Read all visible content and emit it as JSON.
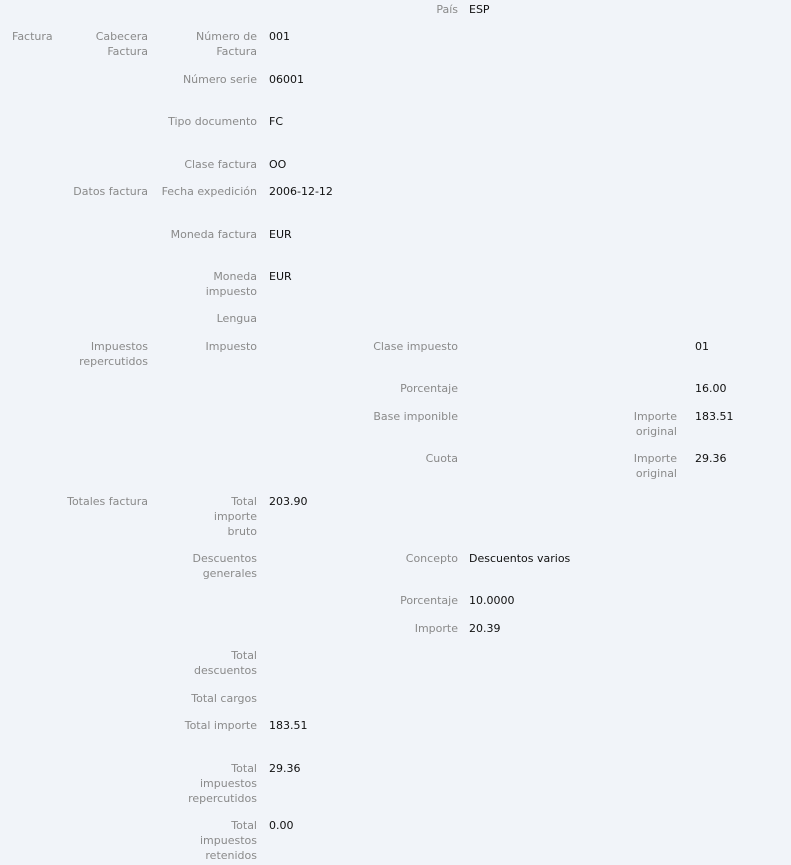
{
  "fields": {
    "pais": {
      "label": "País",
      "value": "ESP"
    },
    "factura": {
      "label": "Factura"
    },
    "cabecera": {
      "label": "Cabecera Factura"
    },
    "numero_factura": {
      "label": "Número de Factura",
      "value": "001"
    },
    "numero_serie": {
      "label": "Número serie",
      "value": "06001"
    },
    "tipo_documento": {
      "label": "Tipo documento",
      "value": "FC"
    },
    "clase_factura": {
      "label": "Clase factura",
      "value": "OO"
    },
    "datos_factura": {
      "label": "Datos factura"
    },
    "fecha_expedicion": {
      "label": "Fecha expedición",
      "value": "2006-12-12"
    },
    "moneda_factura": {
      "label": "Moneda factura",
      "value": "EUR"
    },
    "moneda_impuesto": {
      "label": "Moneda impuesto",
      "value": "EUR"
    },
    "lengua": {
      "label": "Lengua"
    },
    "impuestos_repercutidos": {
      "label": "Impuestos repercutidos"
    },
    "impuesto": {
      "label": "Impuesto"
    },
    "clase_impuesto": {
      "label": "Clase impuesto",
      "value": "01"
    },
    "porcentaje_impuesto": {
      "label": "Porcentaje",
      "value": "16.00"
    },
    "base_imponible": {
      "label": "Base imponible",
      "sublabel": "Importe original",
      "value": "183.51"
    },
    "cuota": {
      "label": "Cuota",
      "sublabel": "Importe original",
      "value": "29.36"
    },
    "totales_factura": {
      "label": "Totales factura"
    },
    "total_importe_bruto": {
      "label": "Total importe bruto",
      "value": "203.90"
    },
    "descuentos_generales": {
      "label": "Descuentos generales"
    },
    "concepto": {
      "label": "Concepto",
      "value": "Descuentos varios"
    },
    "porcentaje_descuento": {
      "label": "Porcentaje",
      "value": "10.0000"
    },
    "importe_descuento": {
      "label": "Importe",
      "value": "20.39"
    },
    "total_descuentos": {
      "label": "Total descuentos"
    },
    "total_cargos": {
      "label": "Total cargos"
    },
    "total_importe": {
      "label": "Total importe",
      "value": "183.51"
    },
    "total_impuestos_repercutidos": {
      "label": "Total impuestos repercutidos",
      "value": "29.36"
    },
    "total_impuestos_retenidos": {
      "label": "Total impuestos retenidos",
      "value": "0.00"
    }
  }
}
